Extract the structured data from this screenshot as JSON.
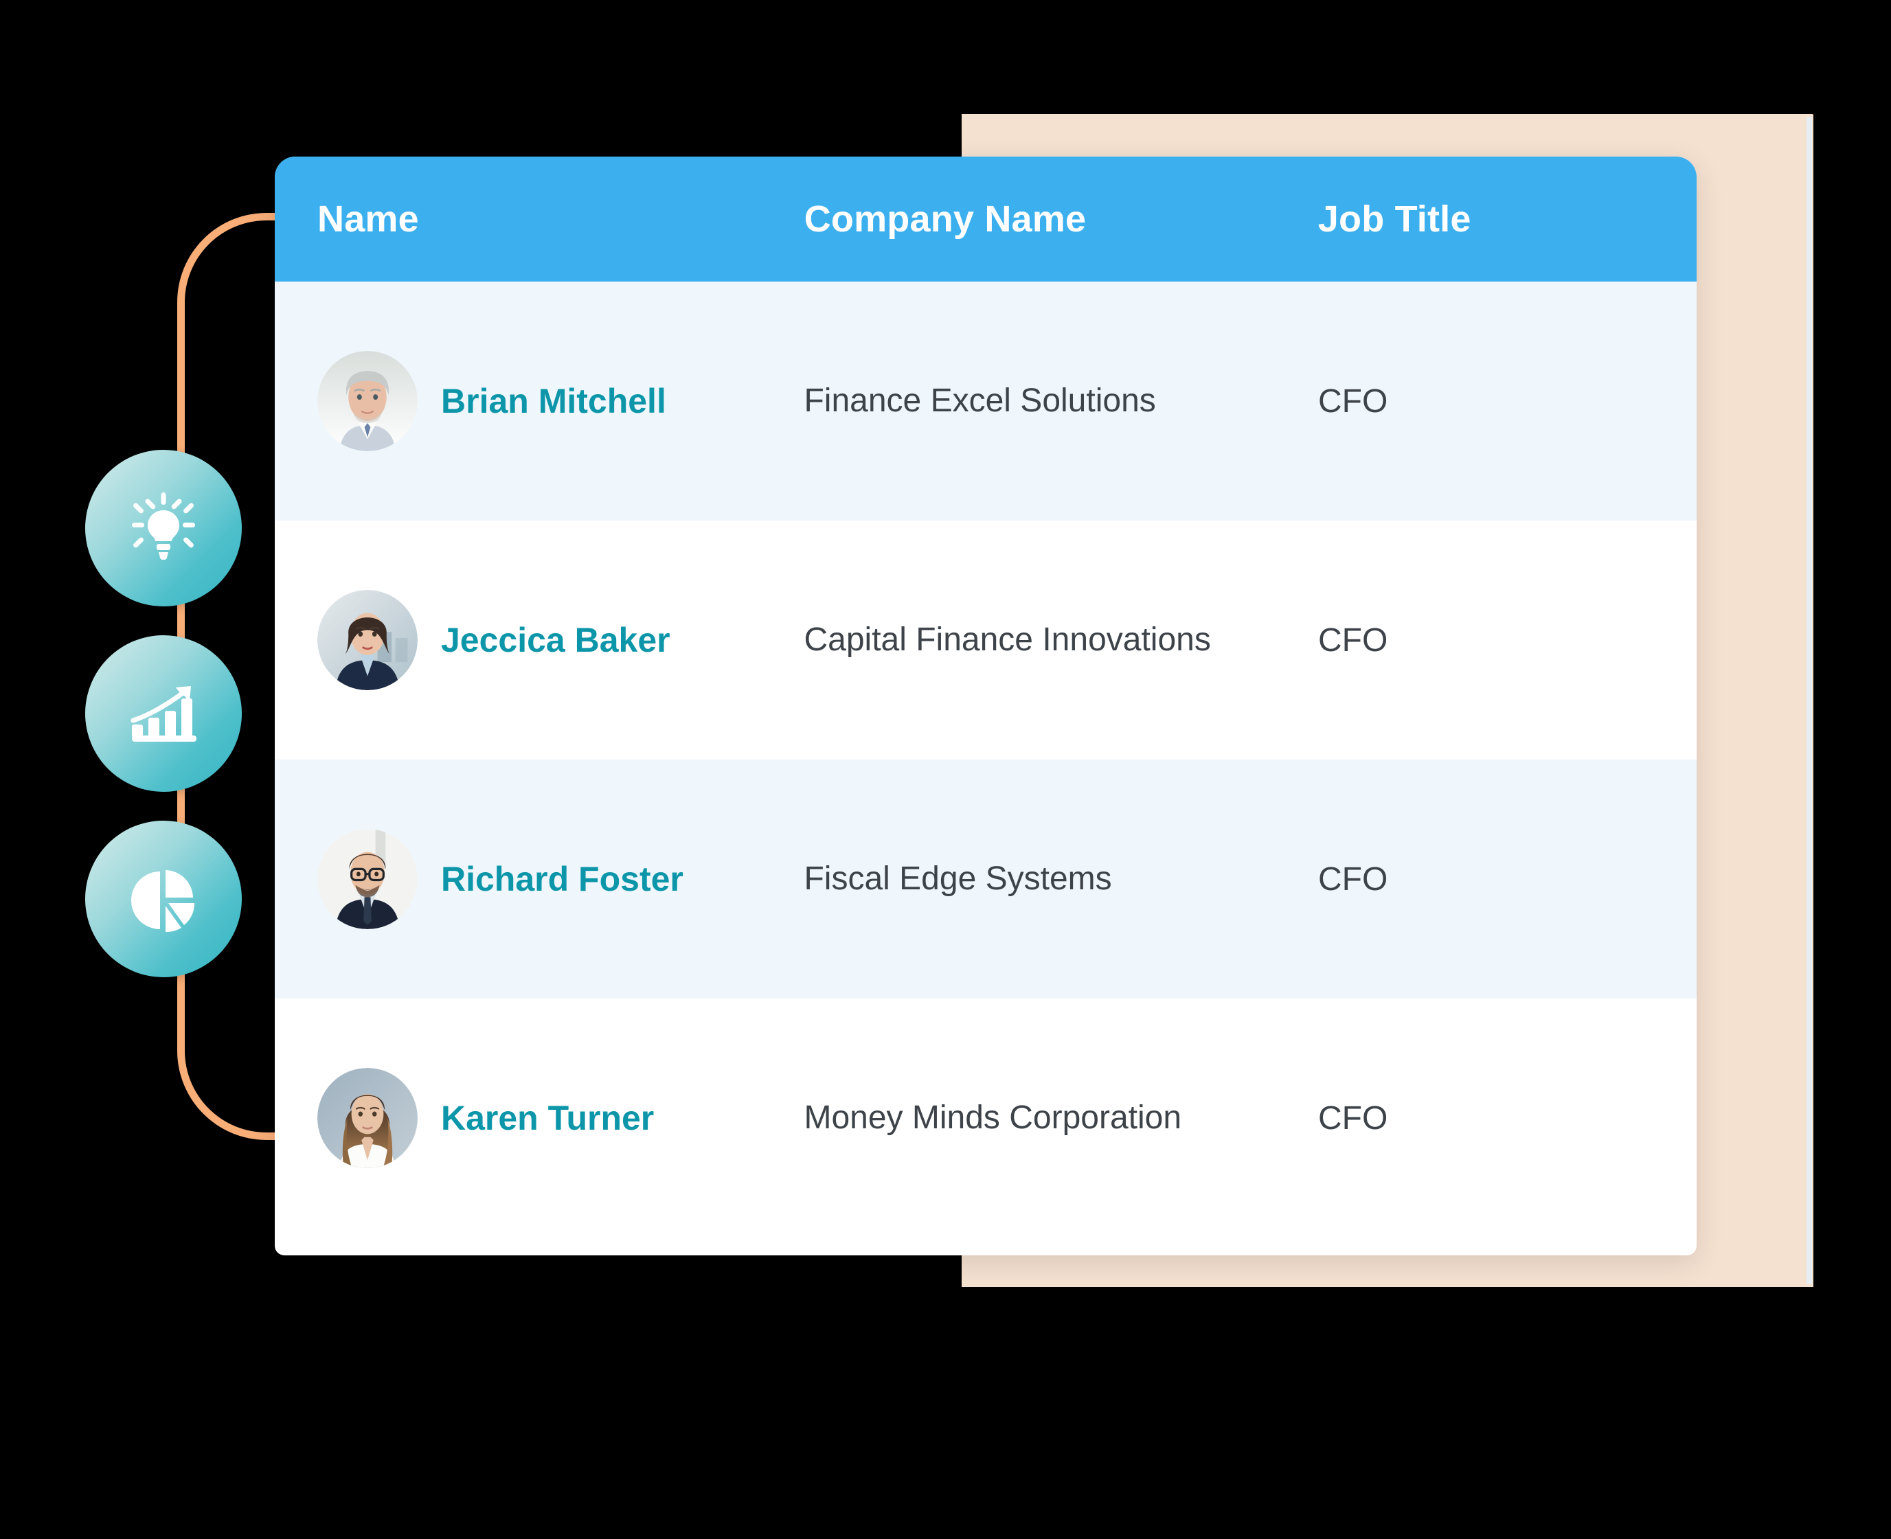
{
  "table": {
    "columns": [
      {
        "key": "name",
        "label": "Name"
      },
      {
        "key": "company",
        "label": "Company Name"
      },
      {
        "key": "job",
        "label": "Job Title"
      }
    ],
    "rows": [
      {
        "name": "Brian Mitchell",
        "company": "Finance Excel Solutions",
        "job": "CFO",
        "avatar": "avatar-man-gray-hair"
      },
      {
        "name": "Jeccica Baker",
        "company": "Capital Finance Innovations",
        "job": "CFO",
        "avatar": "avatar-woman-dark-bob"
      },
      {
        "name": "Richard Foster",
        "company": "Fiscal Edge Systems",
        "job": "CFO",
        "avatar": "avatar-man-glasses-beard"
      },
      {
        "name": "Karen Turner",
        "company": "Money Minds Corporation",
        "job": "CFO",
        "avatar": "avatar-woman-long-hair"
      }
    ]
  },
  "icons": [
    {
      "name": "lightbulb-icon",
      "meaning": "ideas"
    },
    {
      "name": "bar-chart-growth-icon",
      "meaning": "growth analytics"
    },
    {
      "name": "pie-chart-icon",
      "meaning": "data breakdown"
    }
  ],
  "colors": {
    "header_blue": "#3CAFEE",
    "name_teal": "#0D96A9",
    "row_alt": "#EFF7FD",
    "row_plain": "#FFFFFF",
    "peach_panel": "#F5E1D0",
    "bracket_orange": "#F9AE78",
    "icon_gradient_start": "#D7ECEA",
    "icon_gradient_end": "#34B4C2",
    "body_text": "#3D4349",
    "background": "#000000"
  }
}
